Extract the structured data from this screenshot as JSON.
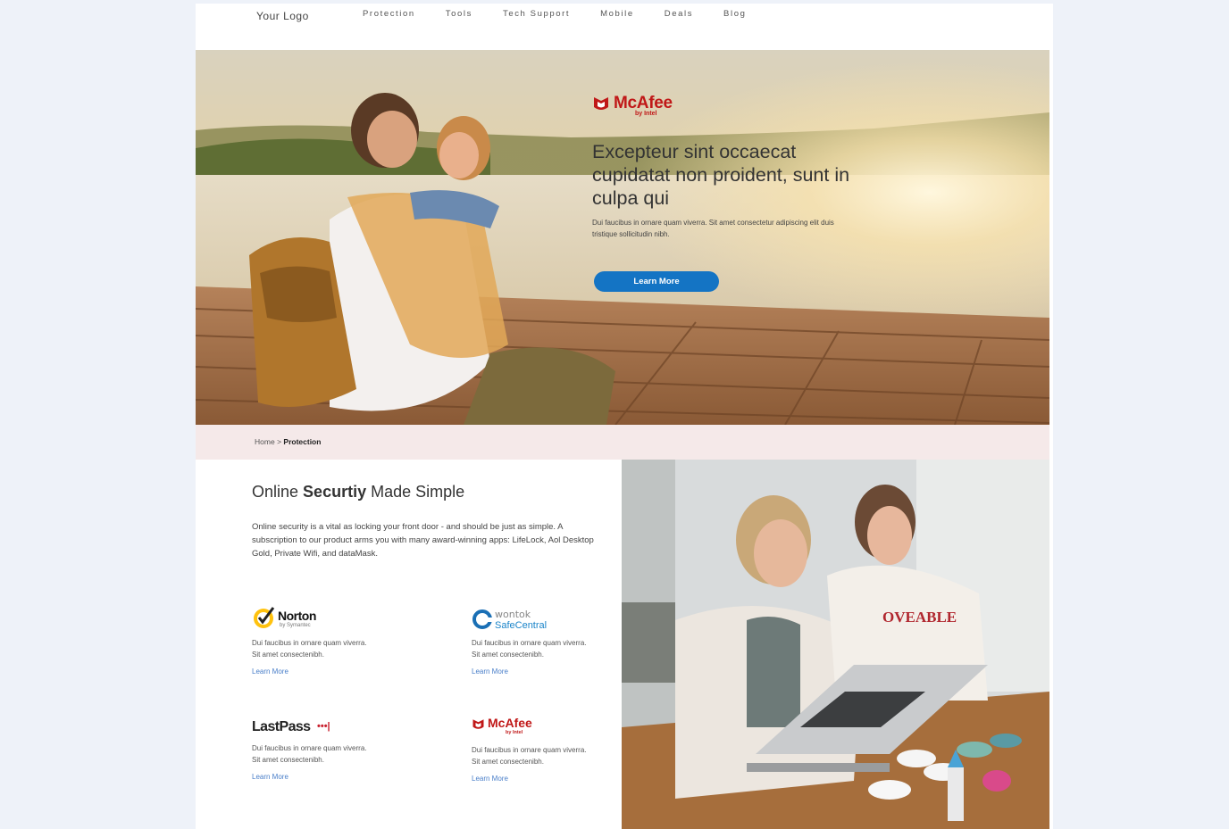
{
  "nav": {
    "logo": "Your Logo",
    "items": [
      "Protection",
      "Tools",
      "Tech Support",
      "Mobile",
      "Deals",
      "Blog"
    ]
  },
  "hero": {
    "brand": "McAfee",
    "brand_sub": "by Intel",
    "title": "Excepteur sint occaecat cupidatat non proident, sunt in culpa qui",
    "text": "Dui faucibus in ornare quam viverra. Sit amet consectetur adipiscing elit duis tristique sollicitudin nibh.",
    "button": "Learn More"
  },
  "breadcrumb": {
    "home": "Home",
    "separator": ">",
    "current": "Protection"
  },
  "section": {
    "title_pre": "Online ",
    "title_bold": "Securtiy",
    "title_post": " Made Simple",
    "lead": "Online security is a vital as locking your front door - and should be just as simple. A subscription to our product arms you with many award-winning apps: LifeLock, Aol Desktop Gold, Private Wifi, and dataMask."
  },
  "cards": [
    {
      "brand": "Norton",
      "brand_sub": "by Symantec",
      "text": "Dui faucibus in ornare quam viverra. Sit amet consectenibh.",
      "link": "Learn More"
    },
    {
      "brand": "wontok",
      "brand_sub": "SafeCentral",
      "text": "Dui faucibus in ornare quam viverra. Sit amet consectenibh.",
      "link": "Learn More"
    },
    {
      "brand": "LastPass",
      "brand_mark": "•••|",
      "text": "Dui faucibus in ornare quam viverra. Sit amet consectenibh.",
      "link": "Learn More"
    },
    {
      "brand": "McAfee",
      "brand_sub": "by Intel",
      "text": "Dui faucibus in ornare quam viverra. Sit amet consectenibh.",
      "link": "Learn More"
    }
  ],
  "photo2_shirt": "OVEABLE",
  "colors": {
    "accent_button": "#1474c4",
    "mcafee_red": "#c01818",
    "breadcrumb_bg": "#f5e9e9",
    "link_blue": "#4a7fc9"
  }
}
